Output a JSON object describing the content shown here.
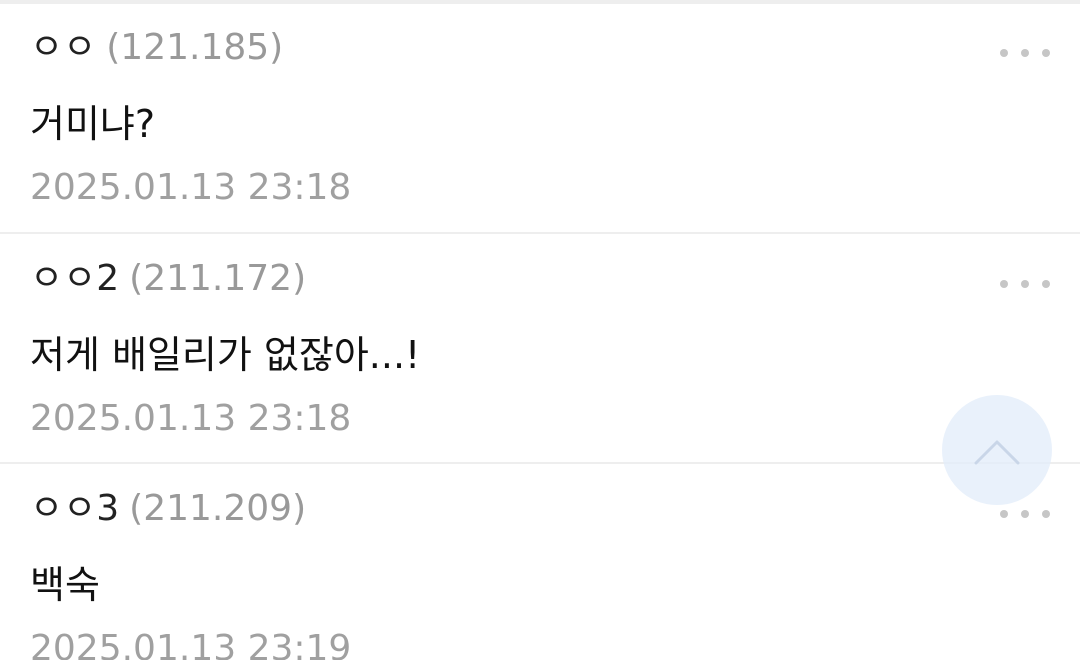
{
  "comments": [
    {
      "author": "ㅇㅇ",
      "ip": "(121.185)",
      "text": "거미냐?",
      "time": "2025.01.13 23:18"
    },
    {
      "author": "ㅇㅇ2",
      "ip": "(211.172)",
      "text": "저게 배일리가 없잖아...!",
      "time": "2025.01.13 23:18"
    },
    {
      "author": "ㅇㅇ3",
      "ip": "(211.209)",
      "text": "백숙",
      "time": "2025.01.13 23:19"
    }
  ],
  "icons": {
    "more": "more-options-icon",
    "scroll_top": "chevron-up-icon"
  },
  "colors": {
    "author": "#222222",
    "meta": "#999999",
    "divider": "#eeeeee",
    "scroll_button_bg": "#e2ecfa"
  }
}
